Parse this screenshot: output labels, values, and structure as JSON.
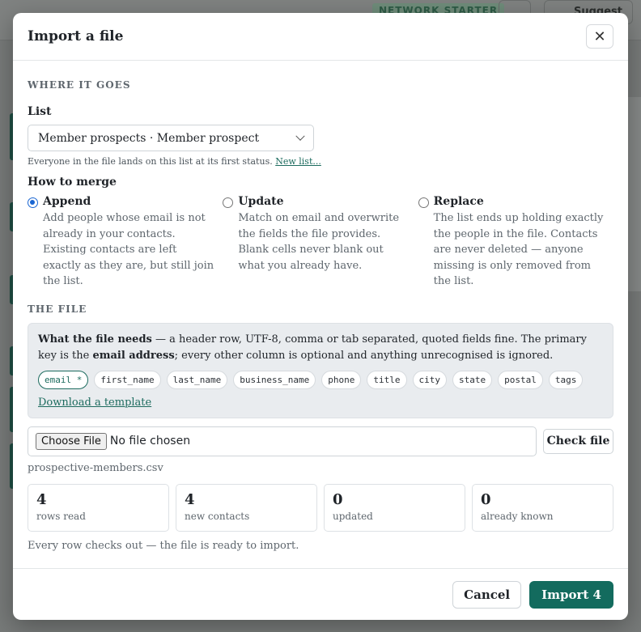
{
  "background": {
    "badge": "NETWORK STARTER",
    "suggest_label": "Suggest"
  },
  "modal": {
    "title": "Import a file",
    "close_icon": "close-icon",
    "where_section": "WHERE IT GOES",
    "list_label": "List",
    "list_selected": "Member prospects · Member prospect",
    "list_hint": "Everyone in the file lands on this list at its first status.",
    "new_list_link": "New list...",
    "merge_label": "How to merge",
    "merge_options": [
      {
        "title": "Append",
        "desc": "Add people whose email is not already in your contacts. Existing contacts are left exactly as they are, but still join the list.",
        "selected": true
      },
      {
        "title": "Update",
        "desc": "Match on email and overwrite the fields the file provides. Blank cells never blank out what you already have.",
        "selected": false
      },
      {
        "title": "Replace",
        "desc": "The list ends up holding exactly the people in the file. Contacts are never deleted — anyone missing is only removed from the list.",
        "selected": false
      }
    ],
    "file_section": "THE FILE",
    "needs_bold": "What the file needs",
    "needs_text": " — a header row, UTF-8, comma or tab separated, quoted fields fine. The primary key is the ",
    "needs_key": "email address",
    "needs_tail": "; every other column is optional and anything unrecognised is ignored.",
    "columns": [
      "email *",
      "first_name",
      "last_name",
      "business_name",
      "phone",
      "title",
      "city",
      "state",
      "postal",
      "tags"
    ],
    "template_link": "Download a template",
    "choose_file": "Choose File",
    "no_file": "No file chosen",
    "check_file": "Check file",
    "filename": "prospective-members.csv",
    "stats": [
      {
        "value": "4",
        "label": "rows read"
      },
      {
        "value": "4",
        "label": "new contacts"
      },
      {
        "value": "0",
        "label": "updated"
      },
      {
        "value": "0",
        "label": "already known"
      }
    ],
    "status": "Every row checks out — the file is ready to import.",
    "cancel": "Cancel",
    "import": "Import 4",
    "accent_color": "#136b5e"
  }
}
